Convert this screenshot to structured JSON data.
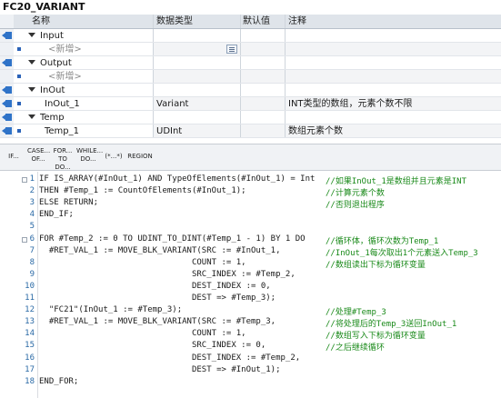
{
  "title": "FC20_VARIANT",
  "table": {
    "headers": {
      "name": "名称",
      "type": "数据类型",
      "default": "默认值",
      "comment": "注释"
    },
    "rows": [
      {
        "kind": "section",
        "name": "Input",
        "icon": "input-icon"
      },
      {
        "kind": "new",
        "name": "<新增>",
        "icon": ""
      },
      {
        "kind": "section",
        "name": "Output",
        "icon": "output-icon"
      },
      {
        "kind": "new",
        "name": "<新增>",
        "icon": ""
      },
      {
        "kind": "section",
        "name": "InOut",
        "icon": "inout-icon"
      },
      {
        "kind": "param",
        "name": "InOut_1",
        "type": "Variant",
        "comment": "INT类型的数组，元素个数不限"
      },
      {
        "kind": "section",
        "name": "Temp",
        "icon": "temp-icon"
      },
      {
        "kind": "param",
        "name": "Temp_1",
        "type": "UDInt",
        "comment": "数组元素个数"
      }
    ]
  },
  "toolbar": {
    "buttons": [
      {
        "l1": "IF...",
        "l2": ""
      },
      {
        "l1": "CASE...",
        "l2": "OF..."
      },
      {
        "l1": "FOR...",
        "l2": "TO DO..."
      },
      {
        "l1": "WHILE...",
        "l2": "DO..."
      },
      {
        "l1": "(*...*)",
        "l2": ""
      },
      {
        "l1": "REGION",
        "l2": ""
      }
    ]
  },
  "code": [
    {
      "n": "1",
      "code": "IF IS_ARRAY(#InOut_1) AND TypeOfElements(#InOut_1) = Int",
      "comment": "//如果InOut_1是数组并且元素是INT"
    },
    {
      "n": "2",
      "code": "THEN #Temp_1 := CountOfElements(#InOut_1);",
      "comment": "//计算元素个数"
    },
    {
      "n": "3",
      "code": "ELSE RETURN;",
      "comment": "//否则退出程序"
    },
    {
      "n": "4",
      "code": "END_IF;",
      "comment": ""
    },
    {
      "n": "5",
      "code": "",
      "comment": ""
    },
    {
      "n": "6",
      "code": "FOR #Temp_2 := 0 TO UDINT_TO_DINT(#Temp_1 - 1) BY 1 DO",
      "comment": "//循环体，循环次数为Temp_1"
    },
    {
      "n": "7",
      "code": "  #RET_VAL_1 := MOVE_BLK_VARIANT(SRC := #InOut_1,",
      "comment": "//InOut_1每次取出1个元素送入Temp_3"
    },
    {
      "n": "8",
      "code": "                               COUNT := 1,",
      "comment": "//数组读出下标为循环变量"
    },
    {
      "n": "9",
      "code": "                               SRC_INDEX := #Temp_2,",
      "comment": ""
    },
    {
      "n": "10",
      "code": "                               DEST_INDEX := 0,",
      "comment": ""
    },
    {
      "n": "11",
      "code": "                               DEST => #Temp_3);",
      "comment": ""
    },
    {
      "n": "12",
      "code": "  \"FC21\"(InOut_1 := #Temp_3);",
      "comment": "//处理#Temp_3"
    },
    {
      "n": "13",
      "code": "  #RET_VAL_1 := MOVE_BLK_VARIANT(SRC := #Temp_3,",
      "comment": "//将处理后的Temp_3送回InOut_1"
    },
    {
      "n": "14",
      "code": "                               COUNT := 1,",
      "comment": "//数组写入下标为循环变量"
    },
    {
      "n": "15",
      "code": "                               SRC_INDEX := 0,",
      "comment": "//之后继续循环"
    },
    {
      "n": "16",
      "code": "                               DEST_INDEX := #Temp_2,",
      "comment": ""
    },
    {
      "n": "17",
      "code": "                               DEST => #InOut_1);",
      "comment": ""
    },
    {
      "n": "18",
      "code": "END_FOR;",
      "comment": ""
    }
  ],
  "colors": {
    "keyword": "#1a1aa8",
    "comment": "#1a8a1a",
    "line_number": "#2b6aa6",
    "header_bg": "#dfe4ea"
  }
}
